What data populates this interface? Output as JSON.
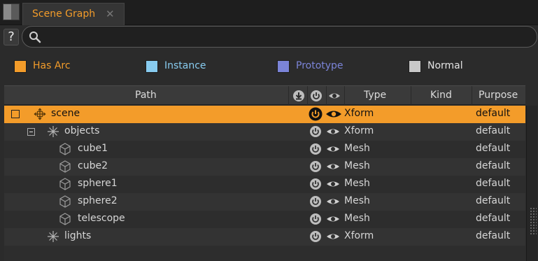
{
  "tab": {
    "title": "Scene Graph",
    "close_glyph": "✕"
  },
  "help_label": "?",
  "search": {
    "placeholder": "",
    "value": ""
  },
  "legend": [
    {
      "label": "Has Arc",
      "color": "#f39c2a",
      "text_color": "#f39c2a"
    },
    {
      "label": "Instance",
      "color": "#88ccf0",
      "text_color": "#88ccf0"
    },
    {
      "label": "Prototype",
      "color": "#7b84d8",
      "text_color": "#7b84d8"
    },
    {
      "label": "Normal",
      "color": "#c8c8c8",
      "text_color": "#e4e4e4"
    }
  ],
  "columns": {
    "path": "Path",
    "load_icon": "download-icon",
    "active_icon": "power-icon",
    "visibility_icon": "eye-icon",
    "type": "Type",
    "kind": "Kind",
    "purpose": "Purpose"
  },
  "rows": [
    {
      "name": "scene",
      "type": "Xform",
      "kind": "",
      "purpose": "default",
      "icon": "scene-root-icon"
    },
    {
      "name": "objects",
      "type": "Xform",
      "kind": "",
      "purpose": "default",
      "icon": "xform-icon"
    },
    {
      "name": "cube1",
      "type": "Mesh",
      "kind": "",
      "purpose": "default",
      "icon": "mesh-icon"
    },
    {
      "name": "cube2",
      "type": "Mesh",
      "kind": "",
      "purpose": "default",
      "icon": "mesh-icon"
    },
    {
      "name": "sphere1",
      "type": "Mesh",
      "kind": "",
      "purpose": "default",
      "icon": "mesh-icon"
    },
    {
      "name": "sphere2",
      "type": "Mesh",
      "kind": "",
      "purpose": "default",
      "icon": "mesh-icon"
    },
    {
      "name": "telescope",
      "type": "Mesh",
      "kind": "",
      "purpose": "default",
      "icon": "mesh-icon"
    },
    {
      "name": "lights",
      "type": "Xform",
      "kind": "",
      "purpose": "default",
      "icon": "xform-icon"
    }
  ],
  "colors": {
    "accent": "#f39c2a",
    "background": "#2b2b2b"
  }
}
